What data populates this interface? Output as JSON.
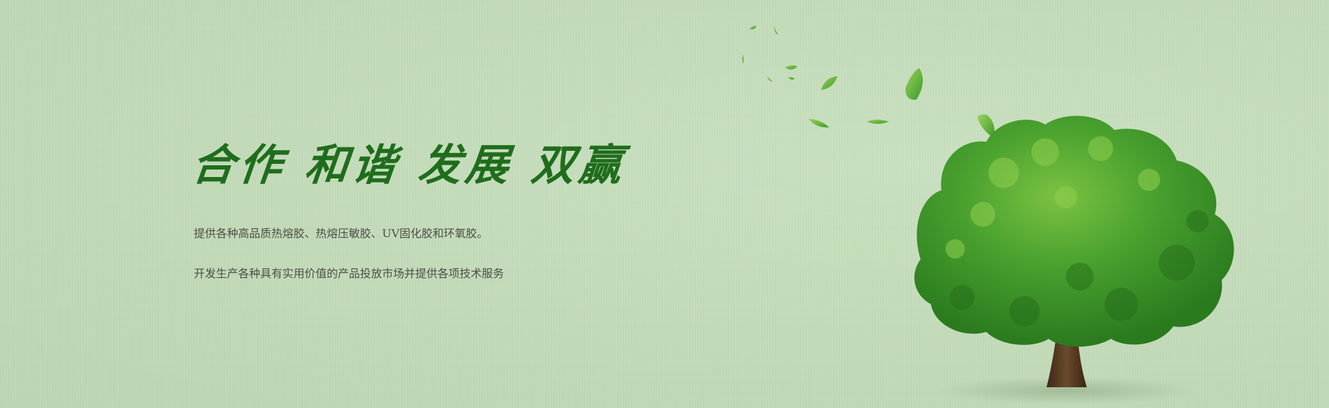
{
  "banner": {
    "slogan": "合作  和谐  发展  双赢",
    "description_line1": "提供各种高品质热熔胶、热熔压敏胶、UV固化胶和环氧胶。",
    "description_line2": "开发生产各种具有实用价值的产品投放市场并提供各项技术服务"
  },
  "colors": {
    "background": "#c3dbba",
    "slogan": "#1f6d1c",
    "text": "#4a4f47",
    "foliage": "#3f9a2a",
    "trunk": "#5a3d24"
  },
  "icons": {
    "tree": "tree-illustration",
    "leaf": "leaf-icon"
  }
}
